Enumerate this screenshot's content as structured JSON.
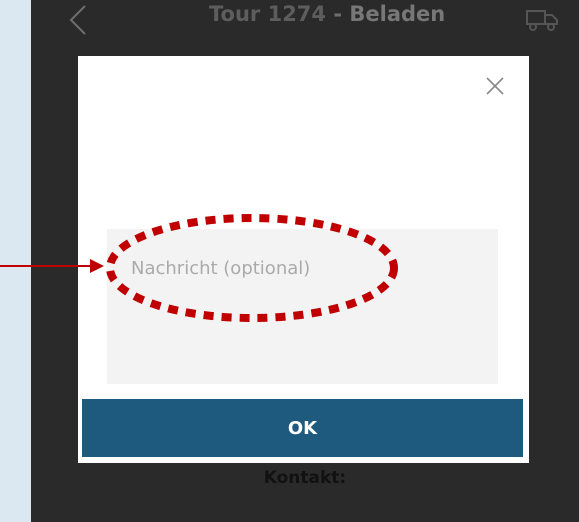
{
  "header": {
    "tour_text": "Tour 1274",
    "separator": " - ",
    "action_text": "Beladen",
    "back_icon": "chevron-left-icon",
    "truck_icon": "truck-icon"
  },
  "dialog": {
    "close_icon": "close-icon",
    "message_placeholder": "Nachricht (optional)",
    "message_value": "",
    "ok_label": "OK"
  },
  "footer": {
    "contact_label": "Kontakt:"
  },
  "annotation": {
    "highlight_color": "#c00000"
  },
  "colors": {
    "primary_button": "#1d5a7e",
    "overlay_background": "#2a2a2a",
    "page_background": "#dce8f1"
  }
}
